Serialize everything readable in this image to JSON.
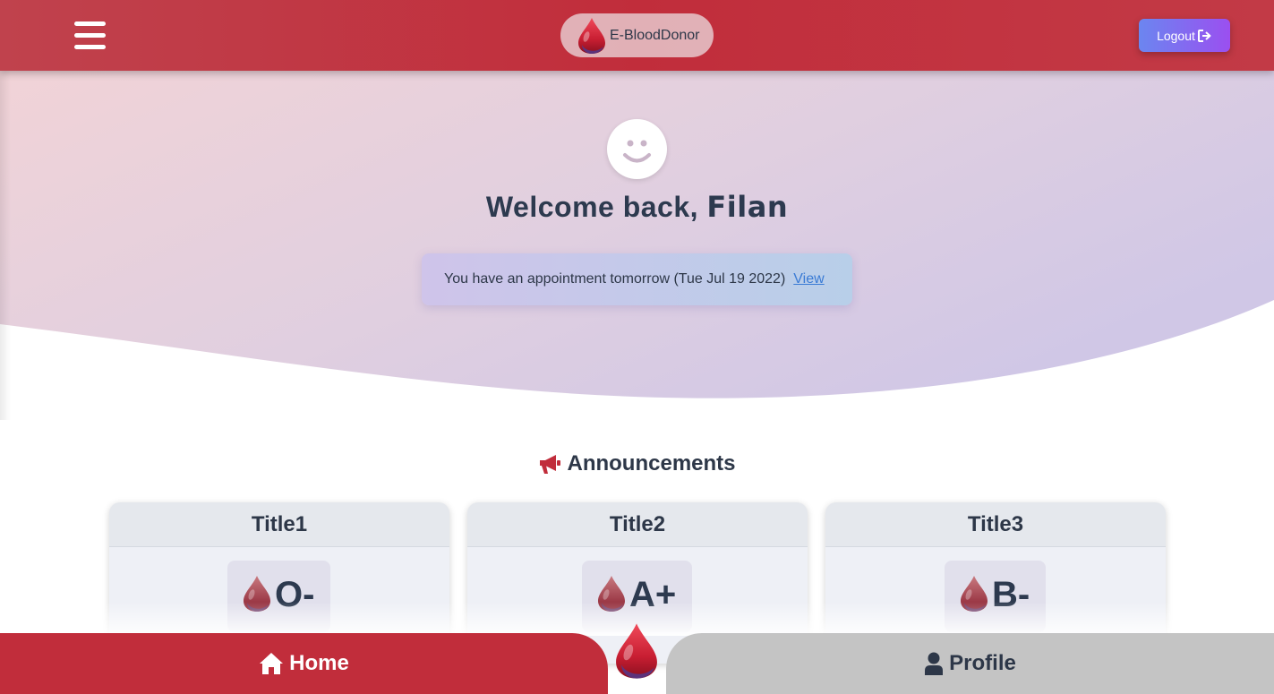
{
  "header": {
    "brand_name": "E-BloodDonor",
    "logout_label": "Logout",
    "menu_icon": "hamburger-menu-icon",
    "logout_icon": "sign-out-icon"
  },
  "hero": {
    "welcome_prefix": "Welcome back, ",
    "user_name": "Filan",
    "appointment_text": "You have an appointment tomorrow (Tue Jul 19 2022)",
    "appointment_link": "View",
    "avatar_icon": "smiley-face-icon"
  },
  "announcements": {
    "heading": "Announcements",
    "heading_icon": "megaphone-icon",
    "cards": [
      {
        "title": "Title1",
        "blood_type": "O-"
      },
      {
        "title": "Title2",
        "blood_type": "A+"
      },
      {
        "title": "Title3",
        "blood_type": "B-"
      }
    ]
  },
  "bottom_nav": {
    "home_label": "Home",
    "profile_label": "Profile",
    "home_icon": "home-icon",
    "profile_icon": "user-icon"
  },
  "colors": {
    "primary_red": "#c12d3b",
    "logout_gradient_start": "#6b86f0",
    "logout_gradient_end": "#9b4ff0",
    "text_dark": "#2d3748",
    "link_blue": "#3a7bd5",
    "profile_gray": "#c4c4c4"
  }
}
